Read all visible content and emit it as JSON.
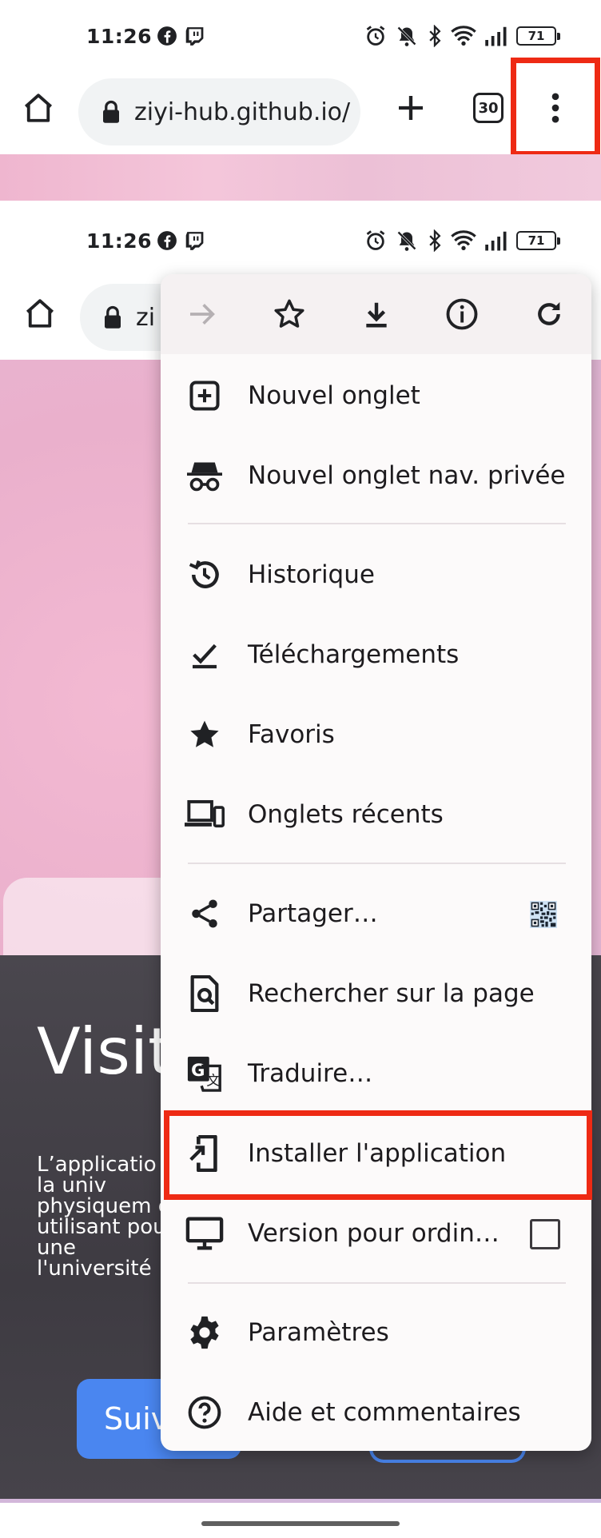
{
  "status_bar_top": {
    "time": "11:26",
    "battery": "71"
  },
  "status_bar_second": {
    "time": "11:26",
    "battery": "71"
  },
  "toolbar": {
    "url": "ziyi-hub.github.io/",
    "tab_count": "30",
    "url_partial": "zi"
  },
  "page": {
    "hero_title": "Visit cam",
    "hero_paragraph": "L’applicatio de la univ physiquem en utilisant pour une l'université",
    "cta_label": "Suiv"
  },
  "menu": {
    "items": [
      {
        "label": "Nouvel onglet",
        "icon": "new-tab-icon"
      },
      {
        "label": "Nouvel onglet nav. privée",
        "icon": "incognito-icon"
      },
      {
        "label": "Historique",
        "icon": "history-icon"
      },
      {
        "label": "Téléchargements",
        "icon": "downloads-icon"
      },
      {
        "label": "Favoris",
        "icon": "star-icon"
      },
      {
        "label": "Onglets récents",
        "icon": "devices-icon"
      },
      {
        "label": "Partager…",
        "icon": "share-icon"
      },
      {
        "label": "Rechercher sur la page",
        "icon": "find-in-page-icon"
      },
      {
        "label": "Traduire…",
        "icon": "translate-icon"
      },
      {
        "label": "Installer l'application",
        "icon": "install-app-icon"
      },
      {
        "label": "Version pour ordin…",
        "icon": "desktop-icon"
      },
      {
        "label": "Paramètres",
        "icon": "settings-icon"
      },
      {
        "label": "Aide et commentaires",
        "icon": "help-icon"
      }
    ],
    "desktop_site_checked": false
  },
  "colors": {
    "highlight": "#ee2a14",
    "accent": "#4a86f0"
  }
}
